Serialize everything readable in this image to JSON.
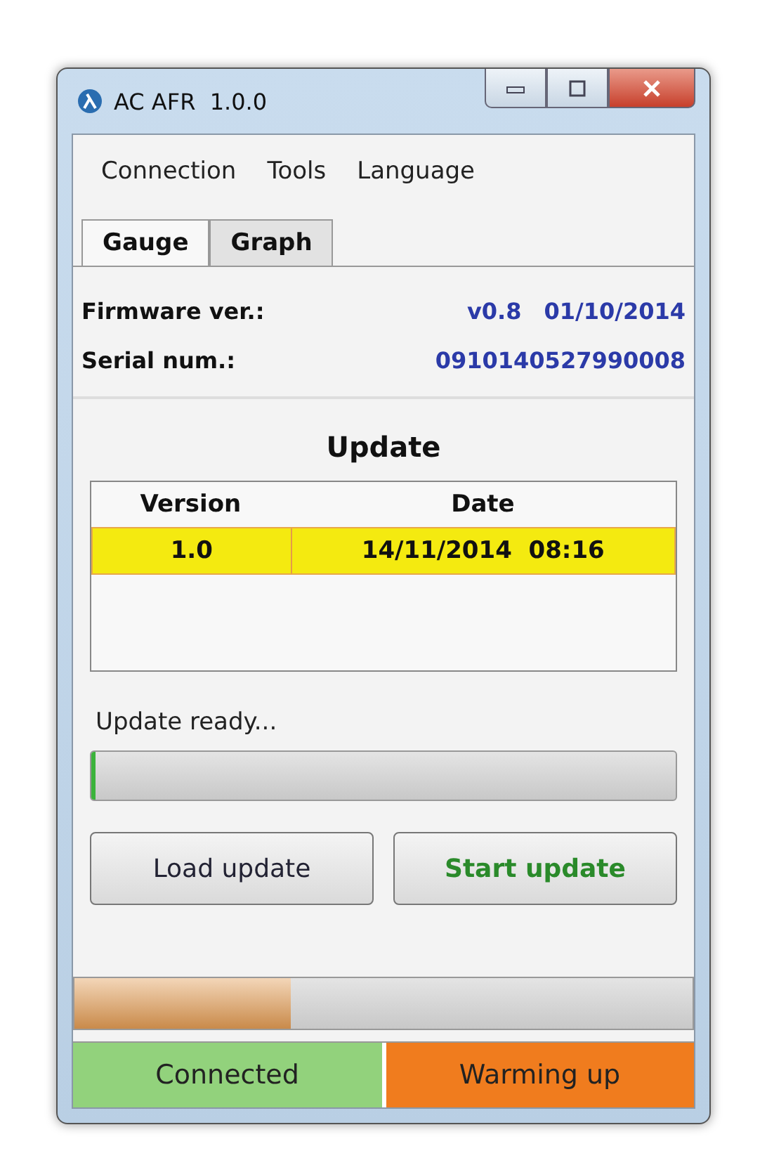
{
  "window": {
    "title": "AC AFR  1.0.0"
  },
  "menu": [
    "Connection",
    "Tools",
    "Language"
  ],
  "tabs": [
    {
      "label": "Gauge",
      "selected": true
    },
    {
      "label": "Graph",
      "selected": false
    }
  ],
  "info": [
    {
      "label": "Firmware ver.:",
      "values": [
        "v0.8",
        "01/10/2014"
      ]
    },
    {
      "label": "Serial num.:",
      "values": [
        "0910140527990008"
      ]
    }
  ],
  "update": {
    "title": "Update",
    "table": {
      "columns": [
        "Version",
        "Date"
      ],
      "rows": [
        {
          "cells": [
            "1.0",
            "14/11/2014  08:16"
          ],
          "selected": true
        }
      ]
    },
    "status": "Update ready...",
    "progress": {
      "level": 0
    },
    "buttons": [
      {
        "label": "Load update",
        "kind": "normal"
      },
      {
        "label": "Start update",
        "kind": "primary"
      }
    ]
  },
  "sensor_progress": {
    "level": 0.35
  },
  "status_bar": [
    {
      "label": "Connected",
      "color": "#92d27c"
    },
    {
      "label": "Warming up",
      "color": "#f07c1e"
    }
  ]
}
